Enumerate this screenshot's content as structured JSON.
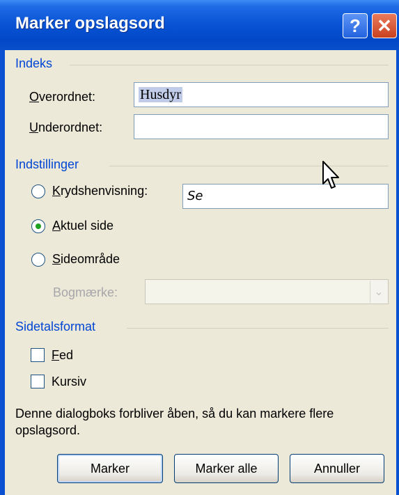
{
  "window": {
    "title": "Marker opslagsord",
    "help_glyph": "?",
    "close_glyph": "✕"
  },
  "index_group": {
    "label": "Indeks",
    "main_entry_label": "Overordnet:",
    "main_entry_value": "Husdyr",
    "sub_entry_label": "Underordnet:",
    "sub_entry_value": ""
  },
  "options_group": {
    "label": "Indstillinger",
    "cross_reference_label": "Krydshenvisning:",
    "cross_reference_value": "Se",
    "current_page_label": "Aktuel side",
    "page_range_label": "Sideområde",
    "bookmark_label": "Bogmærke:",
    "bookmark_value": "",
    "selected_option": "current_page"
  },
  "page_number_format_group": {
    "label": "Sidetalsformat",
    "bold_label": "Fed",
    "bold_checked": false,
    "italic_label": "Kursiv",
    "italic_checked": false
  },
  "info_text": "Denne dialogboks forbliver åben, så du kan markere flere opslagsord.",
  "buttons": {
    "mark": "Marker",
    "mark_all": "Marker alle",
    "cancel": "Annuller"
  },
  "colors": {
    "titlebar": "#0a55d6",
    "group_label": "#0046d5",
    "dialog_bg": "#ece9d8"
  }
}
